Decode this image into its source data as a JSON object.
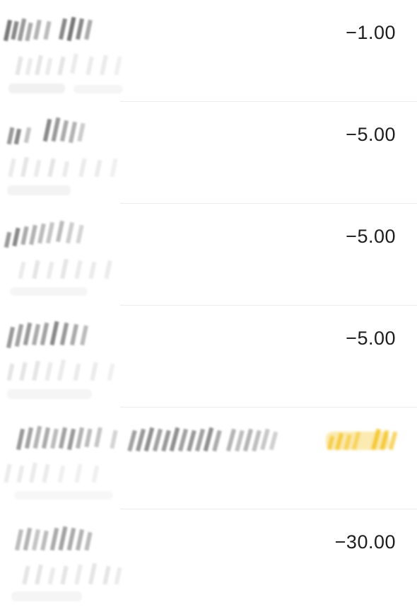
{
  "transactions": [
    {
      "amount": "−1.00"
    },
    {
      "amount": "−5.00"
    },
    {
      "amount": "−5.00"
    },
    {
      "amount": "−5.00"
    },
    {
      "amount": ""
    },
    {
      "amount": "−30.00"
    }
  ],
  "colors": {
    "highlight": "#f4c21f",
    "separator": "#ededed",
    "text": "#1d1d1f"
  }
}
